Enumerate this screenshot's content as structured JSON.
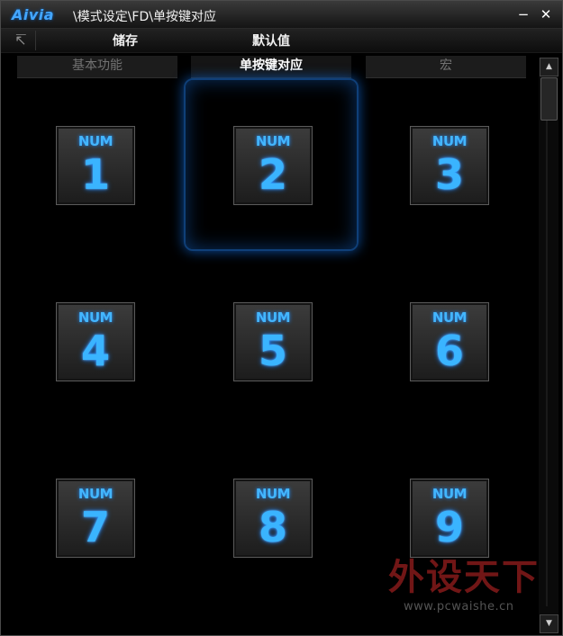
{
  "window": {
    "logo": "Aivia",
    "title": "\\模式设定\\FD\\单按键对应",
    "minimize_glyph": "−",
    "close_glyph": "✕"
  },
  "toolbar": {
    "back_icon": "↸",
    "save_label": "储存",
    "default_label": "默认值"
  },
  "tabs": [
    {
      "label": "基本功能",
      "active": false
    },
    {
      "label": "单按键对应",
      "active": true
    },
    {
      "label": "宏",
      "active": false
    }
  ],
  "keys": [
    {
      "prefix": "NUM",
      "number": "1",
      "selected": false
    },
    {
      "prefix": "NUM",
      "number": "2",
      "selected": true
    },
    {
      "prefix": "NUM",
      "number": "3",
      "selected": false
    },
    {
      "prefix": "NUM",
      "number": "4",
      "selected": false
    },
    {
      "prefix": "NUM",
      "number": "5",
      "selected": false
    },
    {
      "prefix": "NUM",
      "number": "6",
      "selected": false
    },
    {
      "prefix": "NUM",
      "number": "7",
      "selected": false
    },
    {
      "prefix": "NUM",
      "number": "8",
      "selected": false
    },
    {
      "prefix": "NUM",
      "number": "9",
      "selected": false
    }
  ],
  "scrollbar": {
    "up_glyph": "▲",
    "down_glyph": "▼"
  },
  "watermark": {
    "brand": "外设天下",
    "url": "www.pcwaishe.cn"
  },
  "colors": {
    "accent": "#3ab4ff",
    "logo": "#43a6ff",
    "selection_glow": "#0c4ea0",
    "background": "#000000"
  }
}
